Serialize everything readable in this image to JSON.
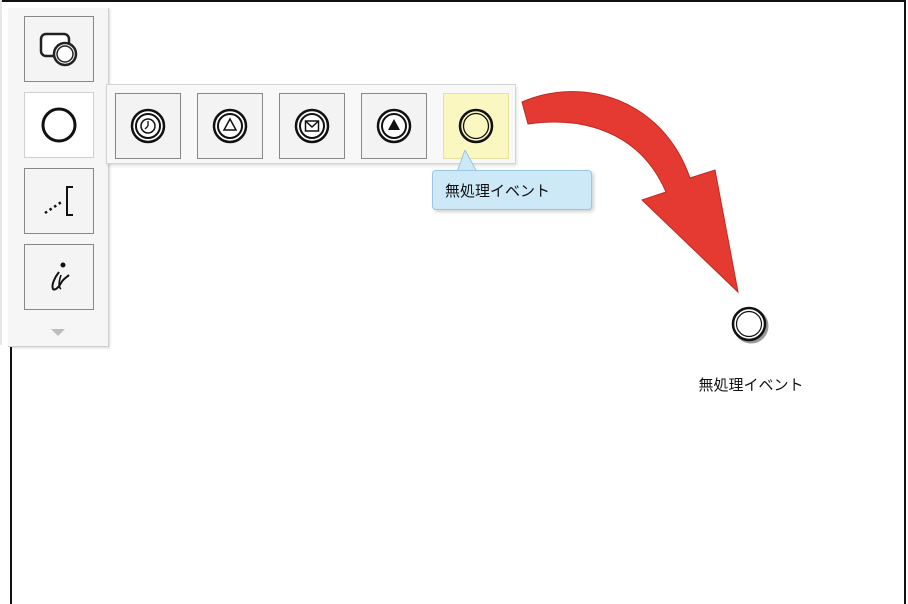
{
  "palette": {
    "tools": [
      {
        "icon": "subprocess-icon"
      },
      {
        "icon": "event-circle-icon",
        "active": true
      },
      {
        "icon": "annotation-icon"
      },
      {
        "icon": "italic-i-info-icon"
      }
    ],
    "scroll_icon": "triangle-down-icon"
  },
  "event_flyout": {
    "items": [
      {
        "icon": "timer-event-icon"
      },
      {
        "icon": "signal-event-icon"
      },
      {
        "icon": "message-event-icon"
      },
      {
        "icon": "escalation-event-icon"
      },
      {
        "icon": "none-event-icon",
        "hovered": true
      }
    ],
    "tooltip": "無処理イベント"
  },
  "canvas": {
    "event_label": "無処理イベント"
  },
  "colors": {
    "arrow": "#e43a32",
    "hover_bg": "#fbf7c0",
    "tooltip_bg": "#cde8f6"
  }
}
